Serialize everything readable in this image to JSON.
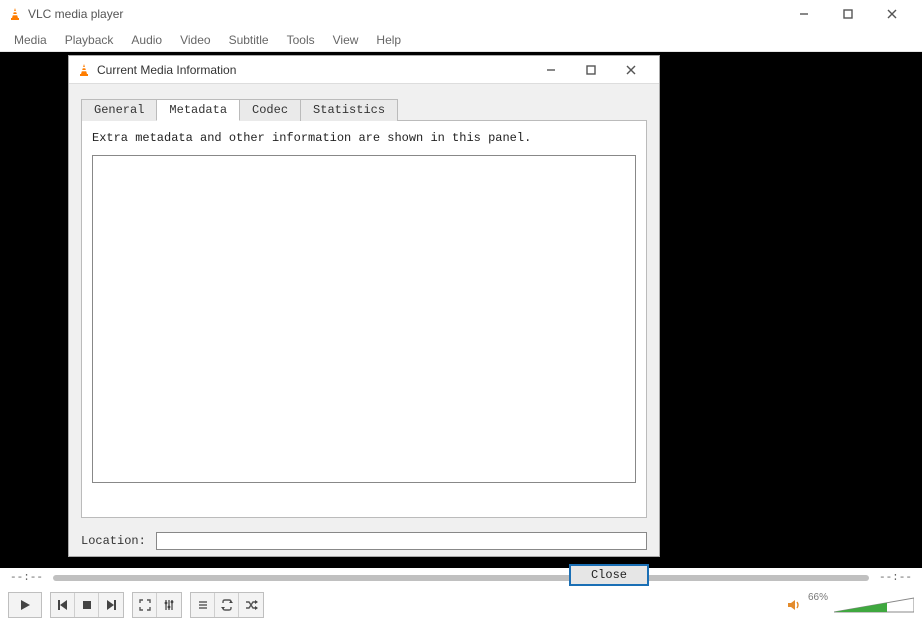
{
  "window": {
    "title": "VLC media player",
    "menu": [
      "Media",
      "Playback",
      "Audio",
      "Video",
      "Subtitle",
      "Tools",
      "View",
      "Help"
    ]
  },
  "dialog": {
    "title": "Current Media Information",
    "tabs": [
      "General",
      "Metadata",
      "Codec",
      "Statistics"
    ],
    "active_tab": "Metadata",
    "panel_text": "Extra metadata and other information are shown in this panel.",
    "location_label": "Location:",
    "location_value": "",
    "close_label": "Close"
  },
  "playback": {
    "time_left": "--:--",
    "time_right": "--:--",
    "volume_label": "66%"
  }
}
